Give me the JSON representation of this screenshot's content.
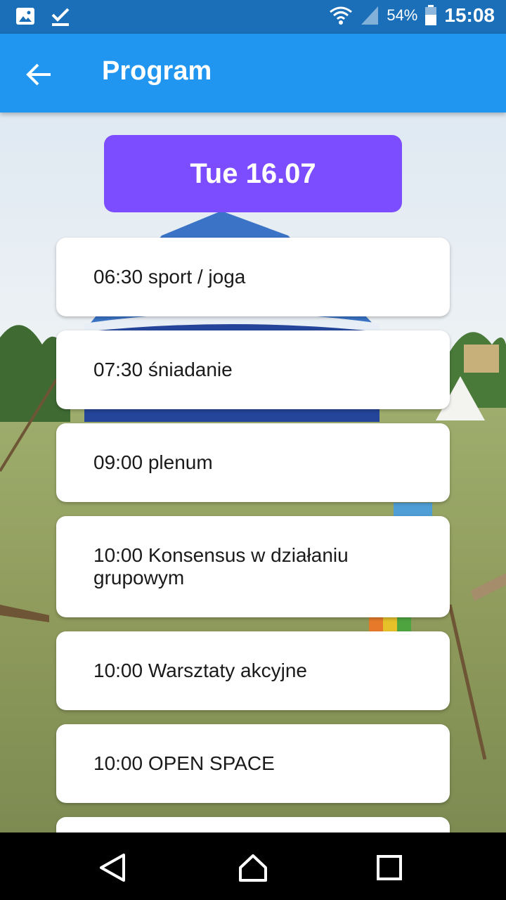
{
  "status_bar": {
    "battery_pct": "54%",
    "time": "15:08",
    "icons": [
      "image-icon",
      "check-icon",
      "wifi-icon",
      "signal-icon",
      "battery-icon"
    ]
  },
  "app_bar": {
    "title": "Program",
    "back_icon": "arrow-left-icon",
    "color": "#2196f0"
  },
  "program": {
    "day_label": "Tue 16.07",
    "day_color": "#7c4dff",
    "events": [
      "06:30 sport / joga",
      "07:30 śniadanie",
      "09:00 plenum",
      "10:00 Konsensus w działaniu grupowym",
      "10:00 Warsztaty akcyjne",
      "10:00 OPEN SPACE",
      ""
    ]
  },
  "nav_bar": {
    "icons": [
      "back-triangle-icon",
      "home-icon",
      "recents-icon"
    ]
  }
}
